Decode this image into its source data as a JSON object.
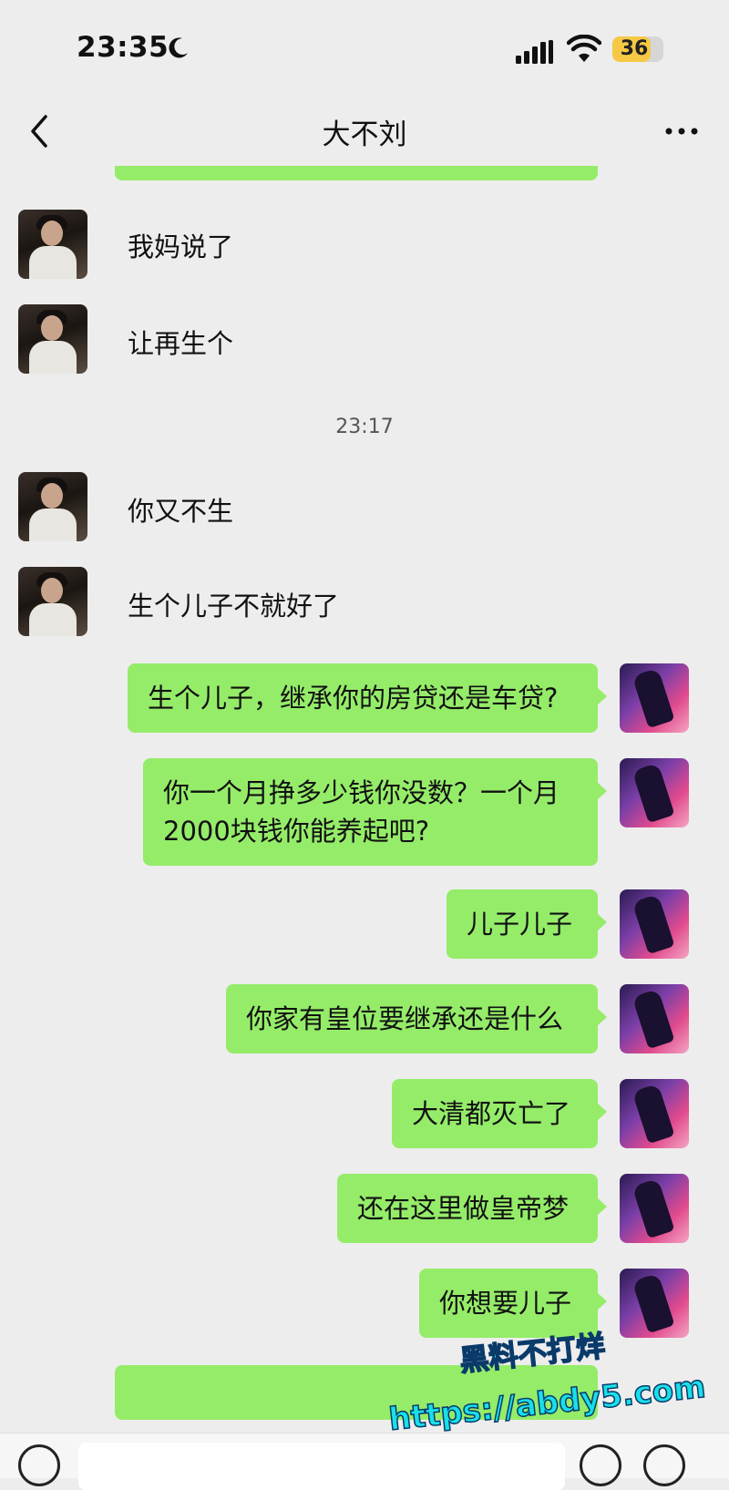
{
  "status_bar": {
    "time": "23:35",
    "battery": "36"
  },
  "header": {
    "title": "大不刘"
  },
  "messages": [
    {
      "side": "left",
      "text": "我妈说了"
    },
    {
      "side": "left",
      "text": "让再生个"
    },
    {
      "side": "time",
      "text": "23:17"
    },
    {
      "side": "left",
      "text": "你又不生"
    },
    {
      "side": "left",
      "text": "生个儿子不就好了"
    },
    {
      "side": "right",
      "text": "生个儿子，继承你的房贷还是车贷?"
    },
    {
      "side": "right",
      "line1": "你一个月挣多少钱你没数？一个月",
      "line2": "2000块钱你能养起吧?"
    },
    {
      "side": "right",
      "text": "儿子儿子"
    },
    {
      "side": "right",
      "text": "你家有皇位要继承还是什么"
    },
    {
      "side": "right",
      "text": "大清都灭亡了"
    },
    {
      "side": "right",
      "text": "还在这里做皇帝梦"
    },
    {
      "side": "right",
      "text": "你想要儿子"
    }
  ],
  "watermark": {
    "line1": "黑料不打烊",
    "line2": "https://abdy5.com"
  },
  "colors": {
    "bubble_green": "#95ec69",
    "background": "#ededed"
  }
}
